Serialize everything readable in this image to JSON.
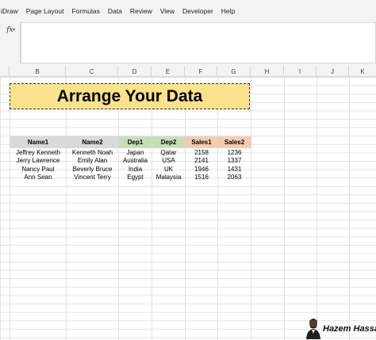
{
  "menu": [
    "iDraw",
    "Page Layout",
    "Formulas",
    "Data",
    "Review",
    "View",
    "Developer",
    "Help"
  ],
  "formula_bar": {
    "fx_label": "fx",
    "value": ""
  },
  "columns": [
    "B",
    "C",
    "D",
    "E",
    "F",
    "G",
    "H",
    "I",
    "J",
    "K"
  ],
  "title": "Arrange Your Data",
  "table": {
    "headers": [
      "Name1",
      "Name2",
      "Dep1",
      "Dep2",
      "Sales1",
      "Sales2"
    ],
    "rows": [
      [
        "Jeffrey Kenneth",
        "Kenneth Noah",
        "Japan",
        "Qatar",
        "2158",
        "1236"
      ],
      [
        "Jerry Lawrence",
        "Emily Alan",
        "Australia",
        "USA",
        "2141",
        "1337"
      ],
      [
        "Nancy Paul",
        "Beverly Bruce",
        "India",
        "UK",
        "1946",
        "1431"
      ],
      [
        "Ann Sean",
        "Vincent Terry",
        "Egypt",
        "Malaysia",
        "1516",
        "2063"
      ]
    ],
    "header_colors": {
      "names": "#d9d9d9",
      "deps": "#c6e0b4",
      "sales": "#f8cbad"
    }
  },
  "watermark": {
    "text": "Hazem Hassa"
  },
  "colors": {
    "title_fill": "#fbe28c",
    "ribbon_bg": "#f3f3f3",
    "grid": "#e1e1e1"
  }
}
